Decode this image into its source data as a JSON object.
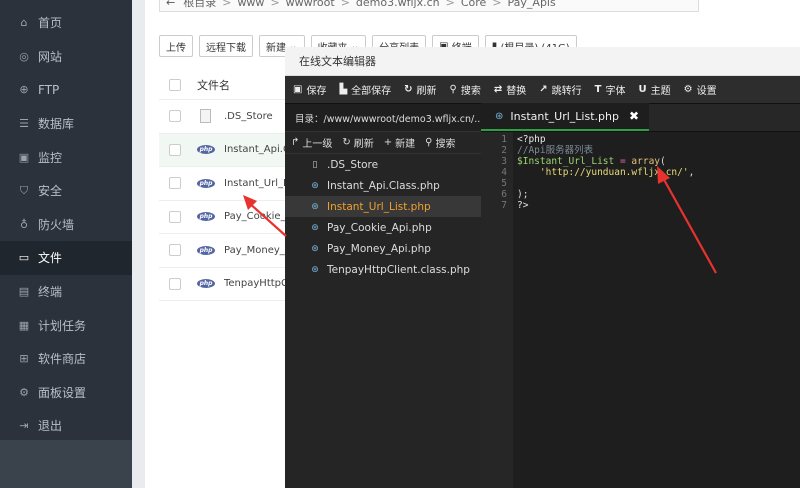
{
  "sidebar": {
    "items": [
      {
        "label": "首页",
        "icon": "home-icon"
      },
      {
        "label": "网站",
        "icon": "globe-icon"
      },
      {
        "label": "FTP",
        "icon": "ftp-icon"
      },
      {
        "label": "数据库",
        "icon": "database-icon"
      },
      {
        "label": "监控",
        "icon": "monitor-icon"
      },
      {
        "label": "安全",
        "icon": "shield-icon"
      },
      {
        "label": "防火墙",
        "icon": "firewall-icon"
      },
      {
        "label": "文件",
        "icon": "folder-icon",
        "active": true
      },
      {
        "label": "终端",
        "icon": "terminal-icon"
      },
      {
        "label": "计划任务",
        "icon": "calendar-icon"
      },
      {
        "label": "软件商店",
        "icon": "grid-icon"
      },
      {
        "label": "面板设置",
        "icon": "gear-icon"
      },
      {
        "label": "退出",
        "icon": "logout-icon"
      }
    ]
  },
  "pathbar": {
    "crumbs": [
      "根目录",
      "www",
      "wwwroot",
      "demo3.wfljx.cn",
      "Core",
      "Pay_Apis"
    ]
  },
  "toolbar": {
    "upload": "上传",
    "remote_download": "远程下载",
    "new": "新建",
    "favorites": "收藏夹",
    "share_list": "分享列表",
    "terminal": "终端",
    "root_dir": "(根目录) (41G)"
  },
  "filelist": {
    "header": "文件名",
    "files": [
      {
        "name": ".DS_Store",
        "type": "doc"
      },
      {
        "name": "Instant_Api.Class.php",
        "type": "php",
        "highlight": true
      },
      {
        "name": "Instant_Url_List.php",
        "type": "php"
      },
      {
        "name": "Pay_Cookie_Api.php",
        "type": "php"
      },
      {
        "name": "Pay_Money_Api.php",
        "type": "php"
      },
      {
        "name": "TenpayHttpClient.class.php",
        "type": "php"
      }
    ]
  },
  "editor": {
    "title": "在线文本编辑器",
    "toolbar": [
      {
        "icon": "save-icon",
        "label": "保存"
      },
      {
        "icon": "save-all-icon",
        "label": "全部保存"
      },
      {
        "icon": "refresh-icon",
        "label": "刷新"
      },
      {
        "icon": "search-icon",
        "label": "搜索"
      },
      {
        "icon": "replace-icon",
        "label": "替换"
      },
      {
        "icon": "goto-line-icon",
        "label": "跳转行"
      },
      {
        "icon": "font-icon",
        "label": "字体"
      },
      {
        "icon": "theme-icon",
        "label": "主题"
      },
      {
        "icon": "gear-icon",
        "label": "设置"
      }
    ],
    "directory": "目录：/www/wwwroot/demo3.wfljx.cn/...",
    "actions": {
      "up": "上一级",
      "refresh": "刷新",
      "new": "新建",
      "search": "搜索"
    },
    "files": [
      {
        "name": ".DS_Store",
        "type": "doc"
      },
      {
        "name": "Instant_Api.Class.php",
        "type": "php"
      },
      {
        "name": "Instant_Url_List.php",
        "type": "php",
        "selected": true
      },
      {
        "name": "Pay_Cookie_Api.php",
        "type": "php"
      },
      {
        "name": "Pay_Money_Api.php",
        "type": "php"
      },
      {
        "name": "TenpayHttpClient.class.php",
        "type": "php"
      }
    ],
    "tab": "Instant_Url_List.php",
    "line_numbers": [
      "1",
      "2",
      "3",
      "4",
      "5",
      "6",
      "7"
    ],
    "code": {
      "l1": "<?php",
      "l2": "//Api服务器列表",
      "l3_var": "$Instant_Url_List",
      "l3_op": " = ",
      "l3_fn": "array",
      "l3_end": "(",
      "l4_str": "    'http://yunduan.wfljx.cn/'",
      "l4_end": ",",
      "l5": "",
      "l6": ");",
      "l7": "?>"
    }
  },
  "colors": {
    "sidebar_bg": "#2b323b",
    "active_tab_underline": "#2ea043",
    "selected_file": "#f0a030",
    "arrow": "#e8322f"
  }
}
